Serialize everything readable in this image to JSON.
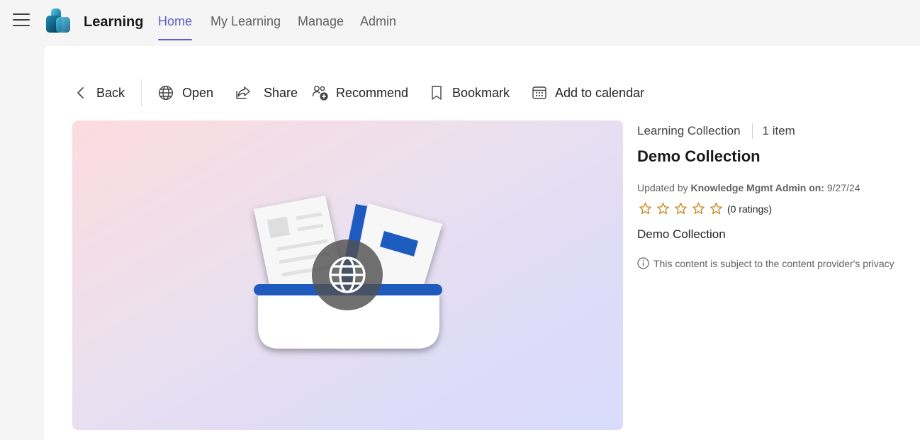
{
  "header": {
    "app_title": "Learning",
    "tabs": [
      {
        "label": "Home",
        "active": true
      },
      {
        "label": "My Learning",
        "active": false
      },
      {
        "label": "Manage",
        "active": false
      },
      {
        "label": "Admin",
        "active": false
      }
    ],
    "accent_color": "#5b5fc7"
  },
  "toolbar": {
    "back": "Back",
    "open": "Open",
    "share": "Share",
    "recommend": "Recommend",
    "bookmark": "Bookmark",
    "add_to_calendar": "Add to calendar"
  },
  "details": {
    "content_type": "Learning Collection",
    "item_count": "1 item",
    "title": "Demo Collection",
    "updated_prefix": "Updated by",
    "updated_by": "Knowledge Mgmt Admin",
    "updated_on_label": "on:",
    "updated_date": "9/27/24",
    "rating_stars": 0,
    "rating_max": 5,
    "ratings_text": "(0 ratings)",
    "description": "Demo Collection",
    "notice": "This content is subject to the content provider's privacy"
  },
  "icons": {
    "menu": "hamburger-icon",
    "back": "chevron-left-icon",
    "open": "globe-icon",
    "share": "share-icon",
    "recommend": "people-add-icon",
    "bookmark": "bookmark-icon",
    "calendar": "calendar-icon",
    "info": "info-icon",
    "star": "star-outline-icon",
    "star_color": "#c87e0b"
  }
}
